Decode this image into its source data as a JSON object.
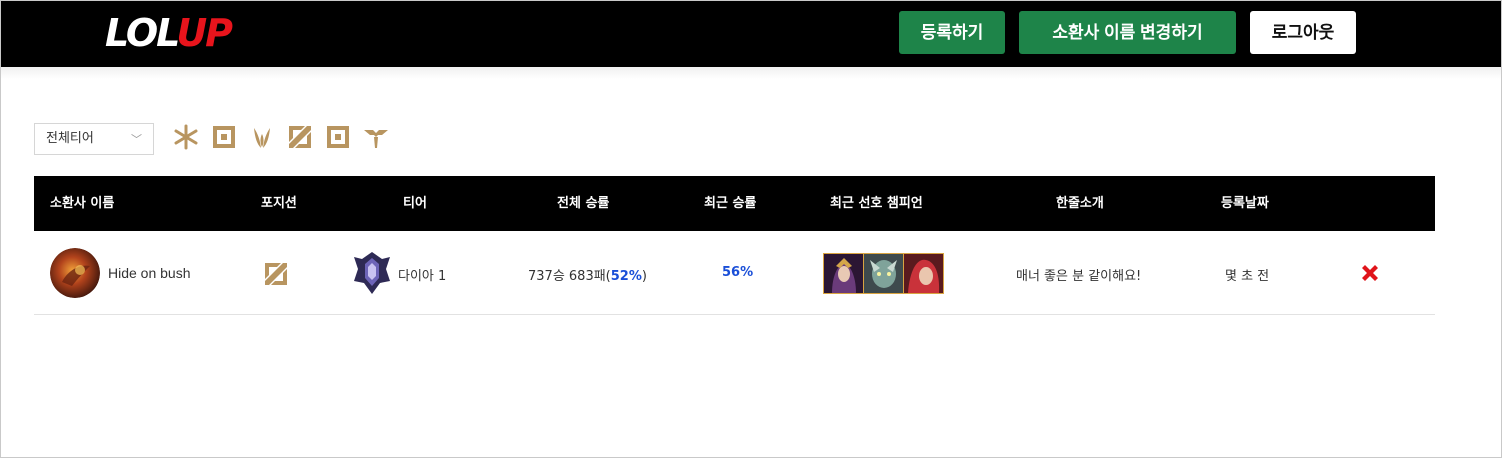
{
  "header": {
    "logo_left": "LOL",
    "logo_right": "UP",
    "register_label": "등록하기",
    "rename_label": "소환사 이름 변경하기",
    "logout_label": "로그아웃"
  },
  "filter": {
    "tier_select_value": "전체티어",
    "position_icons": [
      "all-positions-icon",
      "top-icon",
      "jungle-icon",
      "mid-icon",
      "bottom-icon",
      "support-icon"
    ]
  },
  "table": {
    "headers": [
      "소환사 이름",
      "포지션",
      "티어",
      "전체 승률",
      "최근 승률",
      "최근 선호 챔피언",
      "한줄소개",
      "등록날짜"
    ],
    "rows": [
      {
        "summoner_name": "Hide on bush",
        "position_icon": "mid-icon",
        "tier": "다이아 1",
        "total_record": "737승 683패(",
        "total_winrate": "52%",
        "total_record_close": ")",
        "recent_winrate": "56%",
        "champions": [
          "champion-portrait-1",
          "champion-portrait-2",
          "champion-portrait-3"
        ],
        "intro": "매너 좋은 분 같이해요!",
        "registered": "몇 초 전"
      }
    ]
  },
  "colors": {
    "accent_green": "#1e8449",
    "logo_red": "#e8141c",
    "gold": "#b89560",
    "winrate_blue": "#1a4fd8",
    "delete_red": "#e0141a"
  }
}
